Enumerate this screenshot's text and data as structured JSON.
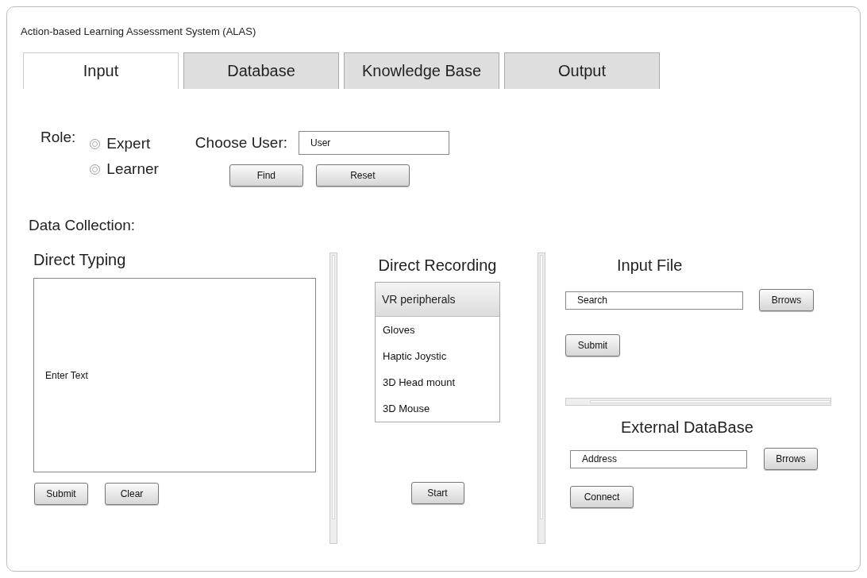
{
  "window": {
    "title": "Action-based Learning Assessment System (ALAS)"
  },
  "tabs": [
    {
      "label": "Input",
      "selected": true
    },
    {
      "label": "Database",
      "selected": false
    },
    {
      "label": "Knowledge Base",
      "selected": false
    },
    {
      "label": "Output",
      "selected": false
    }
  ],
  "role": {
    "label": "Role:",
    "options": [
      {
        "label": "Expert",
        "selected": false
      },
      {
        "label": "Learner",
        "selected": false
      }
    ]
  },
  "user": {
    "label": "Choose User:",
    "field": {
      "placeholder": "User"
    },
    "buttons": [
      "Find",
      "Reset"
    ]
  },
  "data_collection": {
    "label": "Data Collection:"
  },
  "direct_typing": {
    "title": "Direct Typing",
    "field": {
      "placeholder": "Enter Text"
    },
    "buttons": [
      "Submit",
      "Clear"
    ]
  },
  "direct_recording": {
    "title": "Direct Recording",
    "list_header": "VR peripherals",
    "items": [
      {
        "label": "Gloves",
        "selected": false
      },
      {
        "label": "Haptic Joystic",
        "selected": false
      },
      {
        "label": "3D Head mount",
        "selected": false
      },
      {
        "label": "3D Mouse",
        "selected": false
      }
    ],
    "button": "Start"
  },
  "input_file": {
    "title": "Input File",
    "field": {
      "placeholder": "Search"
    },
    "browse_button": "Brrows",
    "submit_button": "Submit"
  },
  "external_database": {
    "title": "External DataBase",
    "field": {
      "placeholder": "Address"
    },
    "browse_button": "Brrows",
    "connect_button": "Connect"
  }
}
